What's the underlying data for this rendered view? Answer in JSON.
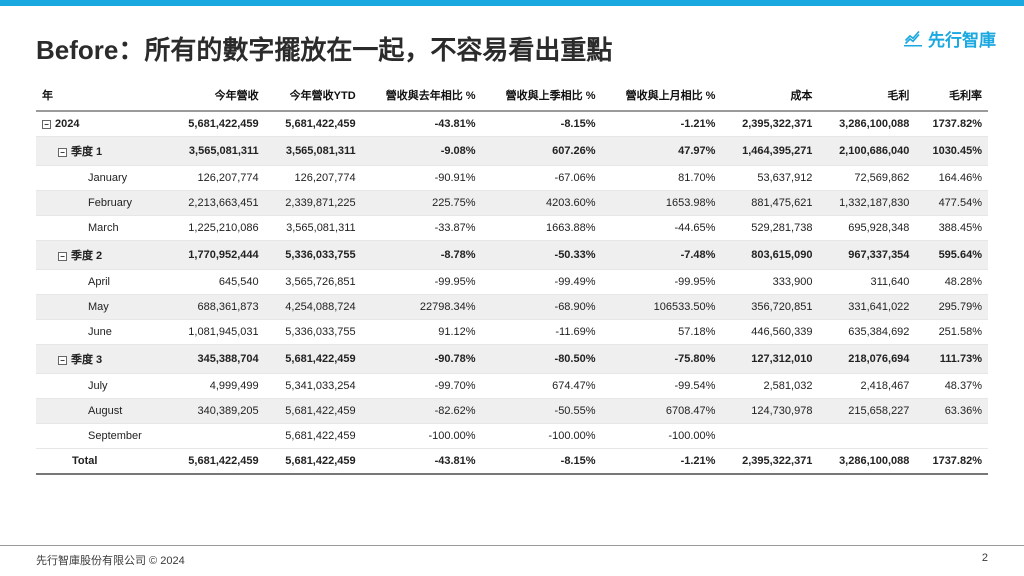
{
  "brand": {
    "name": "先行智庫"
  },
  "title": "Before：所有的數字擺放在一起，不容易看出重點",
  "table": {
    "columns": [
      "年",
      "今年營收",
      "今年營收YTD",
      "營收與去年相比 %",
      "營收與上季相比 %",
      "營收與上月相比 %",
      "成本",
      "毛利",
      "毛利率"
    ],
    "rows": [
      {
        "level": 0,
        "toggle": true,
        "shade": false,
        "cells": [
          "2024",
          "5,681,422,459",
          "5,681,422,459",
          "-43.81%",
          "-8.15%",
          "-1.21%",
          "2,395,322,371",
          "3,286,100,088",
          "1737.82%"
        ]
      },
      {
        "level": 1,
        "toggle": true,
        "shade": true,
        "cells": [
          "季度 1",
          "3,565,081,311",
          "3,565,081,311",
          "-9.08%",
          "607.26%",
          "47.97%",
          "1,464,395,271",
          "2,100,686,040",
          "1030.45%"
        ]
      },
      {
        "level": 2,
        "toggle": false,
        "shade": false,
        "cells": [
          "January",
          "126,207,774",
          "126,207,774",
          "-90.91%",
          "-67.06%",
          "81.70%",
          "53,637,912",
          "72,569,862",
          "164.46%"
        ]
      },
      {
        "level": 2,
        "toggle": false,
        "shade": true,
        "cells": [
          "February",
          "2,213,663,451",
          "2,339,871,225",
          "225.75%",
          "4203.60%",
          "1653.98%",
          "881,475,621",
          "1,332,187,830",
          "477.54%"
        ]
      },
      {
        "level": 2,
        "toggle": false,
        "shade": false,
        "cells": [
          "March",
          "1,225,210,086",
          "3,565,081,311",
          "-33.87%",
          "1663.88%",
          "-44.65%",
          "529,281,738",
          "695,928,348",
          "388.45%"
        ]
      },
      {
        "level": 1,
        "toggle": true,
        "shade": true,
        "cells": [
          "季度 2",
          "1,770,952,444",
          "5,336,033,755",
          "-8.78%",
          "-50.33%",
          "-7.48%",
          "803,615,090",
          "967,337,354",
          "595.64%"
        ]
      },
      {
        "level": 2,
        "toggle": false,
        "shade": false,
        "cells": [
          "April",
          "645,540",
          "3,565,726,851",
          "-99.95%",
          "-99.49%",
          "-99.95%",
          "333,900",
          "311,640",
          "48.28%"
        ]
      },
      {
        "level": 2,
        "toggle": false,
        "shade": true,
        "cells": [
          "May",
          "688,361,873",
          "4,254,088,724",
          "22798.34%",
          "-68.90%",
          "106533.50%",
          "356,720,851",
          "331,641,022",
          "295.79%"
        ]
      },
      {
        "level": 2,
        "toggle": false,
        "shade": false,
        "cells": [
          "June",
          "1,081,945,031",
          "5,336,033,755",
          "91.12%",
          "-11.69%",
          "57.18%",
          "446,560,339",
          "635,384,692",
          "251.58%"
        ]
      },
      {
        "level": 1,
        "toggle": true,
        "shade": true,
        "cells": [
          "季度 3",
          "345,388,704",
          "5,681,422,459",
          "-90.78%",
          "-80.50%",
          "-75.80%",
          "127,312,010",
          "218,076,694",
          "111.73%"
        ]
      },
      {
        "level": 2,
        "toggle": false,
        "shade": false,
        "cells": [
          "July",
          "4,999,499",
          "5,341,033,254",
          "-99.70%",
          "674.47%",
          "-99.54%",
          "2,581,032",
          "2,418,467",
          "48.37%"
        ]
      },
      {
        "level": 2,
        "toggle": false,
        "shade": true,
        "cells": [
          "August",
          "340,389,205",
          "5,681,422,459",
          "-82.62%",
          "-50.55%",
          "6708.47%",
          "124,730,978",
          "215,658,227",
          "63.36%"
        ]
      },
      {
        "level": 2,
        "toggle": false,
        "shade": false,
        "cells": [
          "September",
          "",
          "5,681,422,459",
          "-100.00%",
          "-100.00%",
          "-100.00%",
          "",
          "",
          ""
        ]
      }
    ],
    "total": {
      "label": "Total",
      "cells": [
        "5,681,422,459",
        "5,681,422,459",
        "-43.81%",
        "-8.15%",
        "-1.21%",
        "2,395,322,371",
        "3,286,100,088",
        "1737.82%"
      ]
    }
  },
  "footer": {
    "copyright": "先行智庫股份有限公司 © 2024",
    "page": "2"
  }
}
